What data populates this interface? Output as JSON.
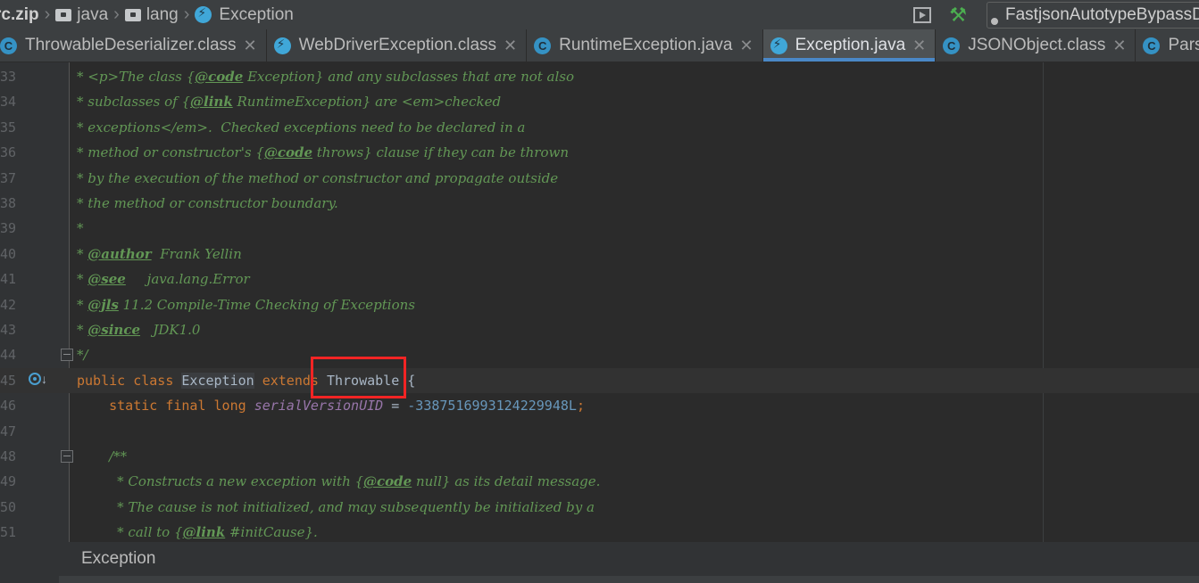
{
  "navbar": {
    "crumbs": [
      {
        "label": "rc.zip"
      },
      {
        "label": "java"
      },
      {
        "label": "lang"
      },
      {
        "label": "Exception"
      }
    ],
    "run_config": "FastjsonAutotypeBypassD"
  },
  "tabs": [
    {
      "label": "ThrowableDeserializer.class",
      "icon": "class-icon"
    },
    {
      "label": "WebDriverException.class",
      "icon": "bolt-icon"
    },
    {
      "label": "RuntimeException.java",
      "icon": "class-icon"
    },
    {
      "label": "Exception.java",
      "icon": "bolt-icon",
      "active": true
    },
    {
      "label": "JSONObject.class",
      "icon": "class-icon"
    },
    {
      "label": "Pars",
      "icon": "class-icon"
    }
  ],
  "lines": [
    {
      "n": "33",
      "parts": [
        [
          "doc",
          "* <p>The class {"
        ],
        [
          "tag",
          "@code"
        ],
        [
          "doc",
          " Exception} and any subclasses that are not also"
        ]
      ]
    },
    {
      "n": "34",
      "parts": [
        [
          "doc",
          "* subclasses of {"
        ],
        [
          "tag",
          "@link"
        ],
        [
          "doc",
          " RuntimeException} are <em>checked"
        ]
      ]
    },
    {
      "n": "35",
      "parts": [
        [
          "doc",
          "* exceptions</em>.  Checked exceptions need to be declared in a"
        ]
      ]
    },
    {
      "n": "36",
      "parts": [
        [
          "doc",
          "* method or constructor's {"
        ],
        [
          "tag",
          "@code"
        ],
        [
          "doc",
          " throws} clause if they can be thrown"
        ]
      ]
    },
    {
      "n": "37",
      "parts": [
        [
          "doc",
          "* by the execution of the method or constructor and propagate outside"
        ]
      ]
    },
    {
      "n": "38",
      "parts": [
        [
          "doc",
          "* the method or constructor boundary."
        ]
      ]
    },
    {
      "n": "39",
      "parts": [
        [
          "doc",
          "*"
        ]
      ]
    },
    {
      "n": "40",
      "parts": [
        [
          "doc",
          "* "
        ],
        [
          "tag",
          "@author"
        ],
        [
          "doc",
          "  Frank Yellin"
        ]
      ]
    },
    {
      "n": "41",
      "parts": [
        [
          "doc",
          "* "
        ],
        [
          "tag",
          "@see"
        ],
        [
          "doc",
          "     java.lang.Error"
        ]
      ]
    },
    {
      "n": "42",
      "parts": [
        [
          "doc",
          "* "
        ],
        [
          "tag",
          "@jls"
        ],
        [
          "doc",
          " 11.2 Compile-Time Checking of Exceptions"
        ]
      ]
    },
    {
      "n": "43",
      "parts": [
        [
          "doc",
          "* "
        ],
        [
          "tag",
          "@since"
        ],
        [
          "doc",
          "   JDK1.0"
        ]
      ]
    },
    {
      "n": "44",
      "parts": [
        [
          "doc",
          "*/"
        ]
      ]
    },
    {
      "n": "45",
      "parts": [
        [
          "kw",
          "public class "
        ],
        [
          "hl",
          "Exception"
        ],
        [
          "kw",
          " extends "
        ],
        [
          "plain",
          "Throwable {"
        ]
      ]
    },
    {
      "n": "46",
      "parts": [
        [
          "plain",
          "    "
        ],
        [
          "kw",
          "static final long "
        ],
        [
          "field",
          "serialVersionUID"
        ],
        [
          "plain",
          " = "
        ],
        [
          "num",
          "-3387516993124229948L"
        ],
        [
          "kw",
          ";"
        ]
      ]
    },
    {
      "n": "47",
      "parts": []
    },
    {
      "n": "48",
      "parts": [
        [
          "plain",
          "    "
        ],
        [
          "doc",
          "/**"
        ]
      ]
    },
    {
      "n": "49",
      "parts": [
        [
          "plain",
          "     "
        ],
        [
          "doc",
          "* Constructs a new exception with {"
        ],
        [
          "tag",
          "@code"
        ],
        [
          "doc",
          " null} as its detail message."
        ]
      ]
    },
    {
      "n": "50",
      "parts": [
        [
          "plain",
          "     "
        ],
        [
          "doc",
          "* The cause is not initialized, and may subsequently be initialized by a"
        ]
      ]
    },
    {
      "n": "51",
      "parts": [
        [
          "plain",
          "     "
        ],
        [
          "doc",
          "* call to {"
        ],
        [
          "tag",
          "@link"
        ],
        [
          "doc",
          " #initCause}."
        ]
      ]
    }
  ],
  "bottom": {
    "label": "Exception"
  }
}
